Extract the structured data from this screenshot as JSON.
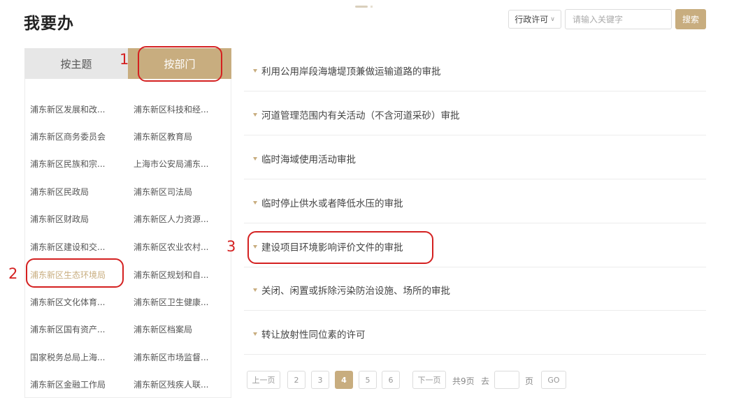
{
  "page": {
    "title": "我要办"
  },
  "search": {
    "type_selected": "行政许可",
    "placeholder": "请输入关键字",
    "button_label": "搜索"
  },
  "tabs": [
    {
      "label": "按主题",
      "active": false
    },
    {
      "label": "按部门",
      "active": true
    }
  ],
  "departments": [
    {
      "name": "浦东新区发展和改...",
      "active": false
    },
    {
      "name": "浦东新区科技和经...",
      "active": false
    },
    {
      "name": "浦东新区商务委员会",
      "active": false
    },
    {
      "name": "浦东新区教育局",
      "active": false
    },
    {
      "name": "浦东新区民族和宗...",
      "active": false
    },
    {
      "name": "上海市公安局浦东...",
      "active": false
    },
    {
      "name": "浦东新区民政局",
      "active": false
    },
    {
      "name": "浦东新区司法局",
      "active": false
    },
    {
      "name": "浦东新区财政局",
      "active": false
    },
    {
      "name": "浦东新区人力资源...",
      "active": false
    },
    {
      "name": "浦东新区建设和交...",
      "active": false
    },
    {
      "name": "浦东新区农业农村...",
      "active": false
    },
    {
      "name": "浦东新区生态环境局",
      "active": true
    },
    {
      "name": "浦东新区规划和自...",
      "active": false
    },
    {
      "name": "浦东新区文化体育...",
      "active": false
    },
    {
      "name": "浦东新区卫生健康...",
      "active": false
    },
    {
      "name": "浦东新区国有资产...",
      "active": false
    },
    {
      "name": "浦东新区档案局",
      "active": false
    },
    {
      "name": "国家税务总局上海...",
      "active": false
    },
    {
      "name": "浦东新区市场监督...",
      "active": false
    },
    {
      "name": "浦东新区金融工作局",
      "active": false
    },
    {
      "name": "浦东新区残疾人联...",
      "active": false
    }
  ],
  "items": [
    "利用公用岸段海塘堤顶兼做运输道路的审批",
    "河道管理范围内有关活动（不含河道采砂）审批",
    "临时海域使用活动审批",
    "临时停止供水或者降低水压的审批",
    "建设项目环境影响评价文件的审批",
    "关闭、闲置或拆除污染防治设施、场所的审批",
    "转让放射性同位素的许可"
  ],
  "pagination": {
    "prev": "上一页",
    "pages": [
      "2",
      "3",
      "4",
      "5",
      "6"
    ],
    "current": "4",
    "next": "下一页",
    "total": "共9页",
    "goto_label": "去",
    "page_unit": "页",
    "go": "GO"
  },
  "annotations": [
    "1",
    "2",
    "3"
  ],
  "colors": {
    "accent": "#c8ad7f",
    "annotation": "#d42020"
  }
}
